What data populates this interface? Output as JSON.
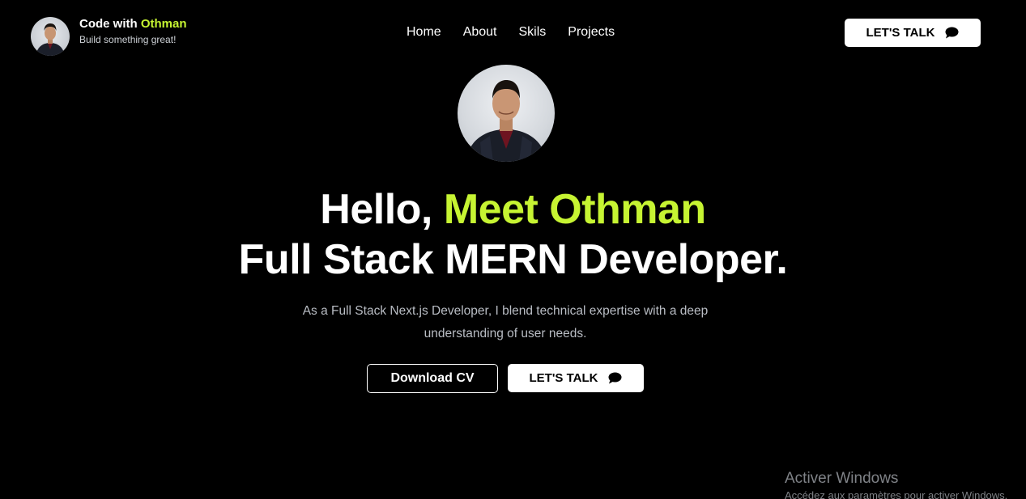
{
  "brand": {
    "name_prefix": "Code with ",
    "name_accent": "Othman",
    "tagline": "Build something great!"
  },
  "nav": {
    "items": [
      {
        "label": "Home"
      },
      {
        "label": "About"
      },
      {
        "label": "Skils"
      },
      {
        "label": "Projects"
      }
    ]
  },
  "header_cta": {
    "label": "LET'S TALK",
    "icon": "chat-bubble-icon"
  },
  "hero": {
    "title_prefix": "Hello, ",
    "title_accent": "Meet Othman",
    "title_line2": "Full Stack MERN Developer.",
    "description": "As a Full Stack Next.js Developer, I blend technical expertise with a deep understanding of user needs.",
    "download_label": "Download CV",
    "talk_label": "LET'S TALK"
  },
  "watermark": {
    "title": "Activer Windows",
    "subtitle": "Accédez aux paramètres pour activer Windows."
  },
  "colors": {
    "background": "#000000",
    "accent": "#c6f432",
    "text": "#ffffff",
    "muted_text": "#b9bdc4",
    "button_bg": "#ffffff",
    "button_text": "#000000"
  }
}
